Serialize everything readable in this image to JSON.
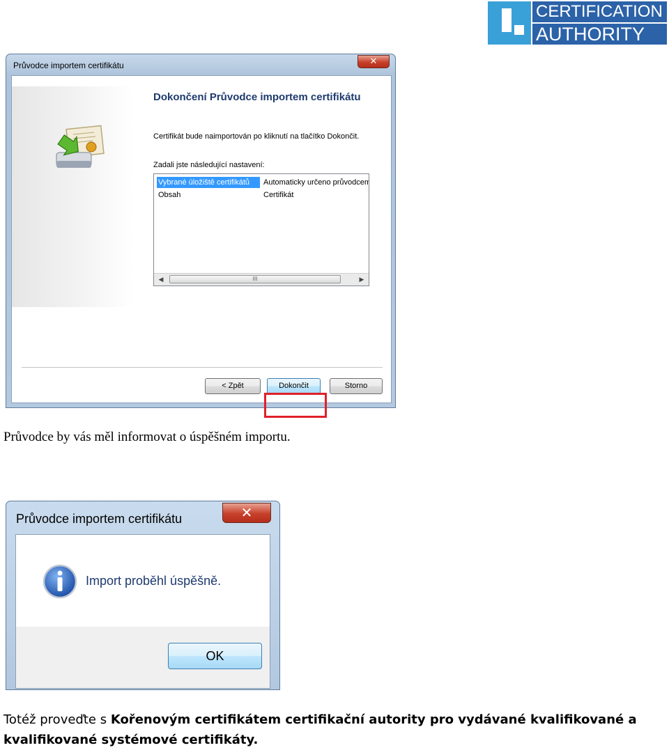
{
  "logo": {
    "line1": "CERTIFICATION",
    "line2": "AUTHORITY",
    "color_primary": "#2b62a8",
    "color_mark": "#3aa0d8"
  },
  "wizard": {
    "title": "Průvodce importem certifikátu",
    "heading": "Dokončení Průvodce importem certifikátu",
    "text": "Certifikát bude naimportován po kliknutí na tlačítko Dokončit.",
    "settings_label": "Zadali jste následující nastavení:",
    "rows": [
      {
        "key": "Vybrané úložiště certifikátů",
        "value": "Automaticky určeno průvodcem"
      },
      {
        "key": "Obsah",
        "value": "Certifikát"
      }
    ],
    "scroll_thumb": "III",
    "back_label": "< Zpět",
    "finish_label": "Dokončit",
    "cancel_label": "Storno",
    "highlight_color": "#e0202a"
  },
  "caption": "Průvodce by vás měl informovat o úspěšném importu.",
  "message_box": {
    "title": "Průvodce importem certifikátu",
    "text": "Import proběhl úspěšně.",
    "ok_label": "OK",
    "icon": "info-icon"
  },
  "bottom_text": {
    "prefix": "Totéž proveďte s ",
    "bold": "Kořenovým certifikátem certifikační autority pro vydávané kvalifikované a kvalifikované systémové certifikáty."
  }
}
